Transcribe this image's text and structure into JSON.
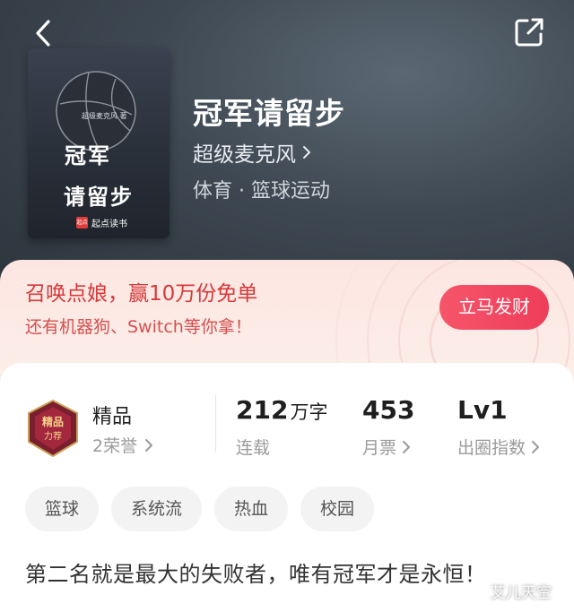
{
  "nav": {
    "back_icon": "chevron-left-icon",
    "share_icon": "share-icon"
  },
  "cover": {
    "author_text": "超级麦克风 著",
    "title_line1": "冠军",
    "title_line2": "请留步",
    "brand": "起点读书",
    "logo_text": "起点"
  },
  "book": {
    "title": "冠军请留步",
    "author": "超级麦克风",
    "genre": "体育 · 篮球运动"
  },
  "promo": {
    "title": "召唤点娘，赢10万份免单",
    "subtitle": "还有机器狗、Switch等你拿！",
    "button": "立马发财",
    "background_color": "#fde6e2",
    "button_color": "#ef4560"
  },
  "stats": {
    "quality": {
      "label": "精品",
      "sub": "2荣誉",
      "badge_text_1": "精品",
      "badge_text_2": "力荐"
    },
    "words": {
      "value": "212",
      "unit": "万字",
      "caption": "连载"
    },
    "votes": {
      "value": "453",
      "caption": "月票"
    },
    "level": {
      "value": "Lv1",
      "caption": "出圈指数"
    }
  },
  "tags": [
    "篮球",
    "系统流",
    "热血",
    "校园"
  ],
  "tagline": "第二名就是最大的失败者，唯有冠军才是永恒！",
  "watermark": "艾儿天空"
}
